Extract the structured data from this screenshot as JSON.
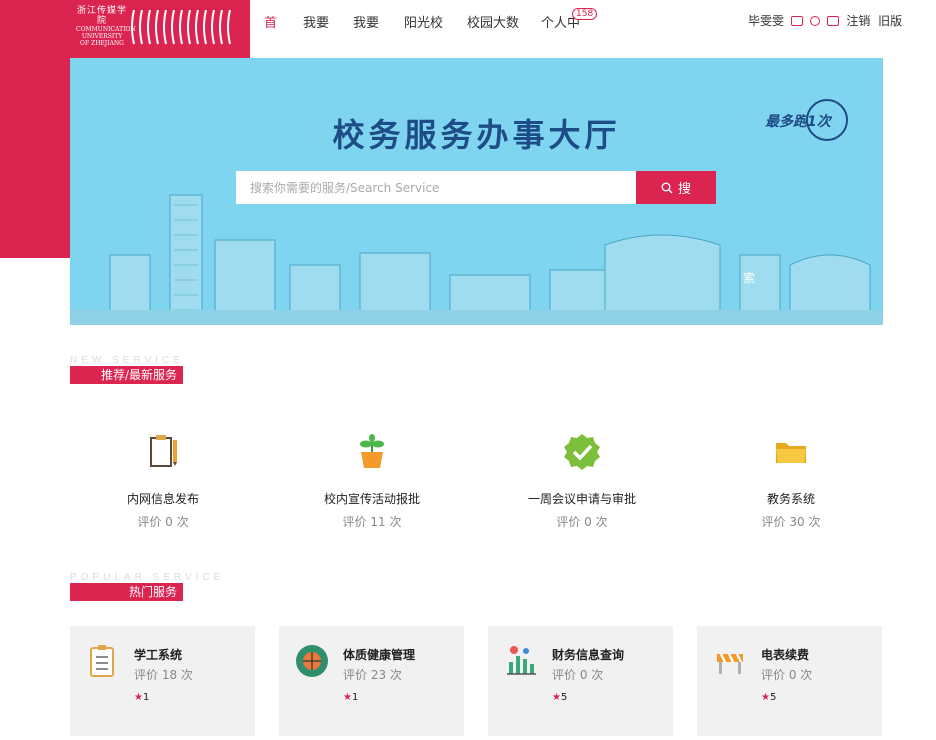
{
  "logo": {
    "cn": "浙江传媒学院",
    "en": [
      "COMMUNICATION",
      "UNIVERSITY",
      "OF ZHEJIANG"
    ]
  },
  "nav": {
    "items": [
      "首",
      "我要",
      "我要",
      "阳光校",
      "校园大数",
      "个人中"
    ],
    "badge": "158"
  },
  "user": {
    "name": "毕雯雯",
    "logout": "注销",
    "old_version": "旧版"
  },
  "hero": {
    "title": "校务服务办事大厅",
    "logo_text": "最多跑1次",
    "search_placeholder": "搜索你需要的服务/Search Service",
    "search_button": "搜",
    "stray_char": "索"
  },
  "new_service": {
    "en": "NEW SERVICE",
    "cn": "推荐/最新服务",
    "items": [
      {
        "name": "内网信息发布",
        "rating": "评价 0 次",
        "icon": "clipboard-pencil-icon"
      },
      {
        "name": "校内宣传活动报批",
        "rating": "评价 11 次",
        "icon": "potted-plant-icon"
      },
      {
        "name": "一周会议申请与审批",
        "rating": "评价 0 次",
        "icon": "green-check-badge-icon"
      },
      {
        "name": "教务系统",
        "rating": "评价 30 次",
        "icon": "folder-icon"
      }
    ]
  },
  "popular_service": {
    "en": "POPULAR SERVICE",
    "cn": "热门服务",
    "items": [
      {
        "name": "学工系统",
        "rating": "评价 18 次",
        "stars": "1",
        "icon": "checklist-icon"
      },
      {
        "name": "体质健康管理",
        "rating": "评价 23 次",
        "stars": "1",
        "icon": "sports-ball-icon"
      },
      {
        "name": "财务信息查询",
        "rating": "评价 0 次",
        "stars": "5",
        "icon": "bar-chart-icon"
      },
      {
        "name": "电表续费",
        "rating": "评价 0 次",
        "stars": "5",
        "icon": "barrier-icon"
      }
    ]
  },
  "colors": {
    "accent": "#dc2451",
    "hero_bg": "#7fd4ef",
    "title": "#1e4c86"
  }
}
